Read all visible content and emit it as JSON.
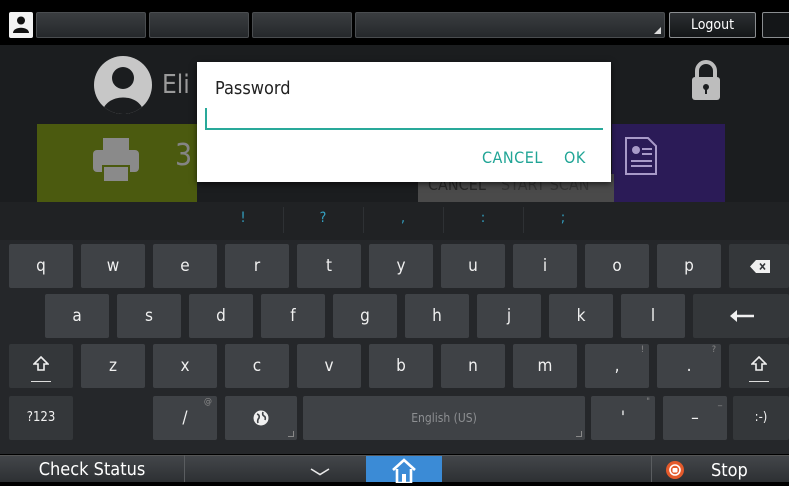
{
  "topbar": {
    "logout_label": "Logout"
  },
  "background_app": {
    "user_name_partial": "Eli",
    "print_count_partial": "3",
    "cancel_label": "CANCEL",
    "start_scan_label": "START SCAN"
  },
  "dialog": {
    "title": "Password",
    "password_value": "",
    "cancel_label": "CANCEL",
    "ok_label": "OK",
    "accent_color": "#29a99a"
  },
  "keyboard": {
    "symbols": [
      "!",
      "?",
      ",",
      ":",
      ";"
    ],
    "row1": [
      "q",
      "w",
      "e",
      "r",
      "t",
      "y",
      "u",
      "i",
      "o",
      "p"
    ],
    "row2": [
      "a",
      "s",
      "d",
      "f",
      "g",
      "h",
      "j",
      "k",
      "l"
    ],
    "row3": [
      "z",
      "x",
      "c",
      "v",
      "b",
      "n",
      "m",
      ",",
      "."
    ],
    "row3_hints": [
      "!",
      "?"
    ],
    "row4": {
      "mode_label": "?123",
      "slash": "/",
      "slash_hint": "@",
      "space_label": "English (US)",
      "apostrophe": "'",
      "apostrophe_hint": "\"",
      "dash": "–",
      "dash_hint": "_",
      "emoticon": ":-)"
    },
    "icons": {
      "backspace": "backspace-icon",
      "enter": "enter-icon",
      "shift": "shift-icon",
      "language": "globe-icon"
    }
  },
  "bottombar": {
    "check_status_label": "Check Status",
    "stop_label": "Stop",
    "home_color": "#3b8bd6",
    "stop_color": "#e45a2b"
  }
}
